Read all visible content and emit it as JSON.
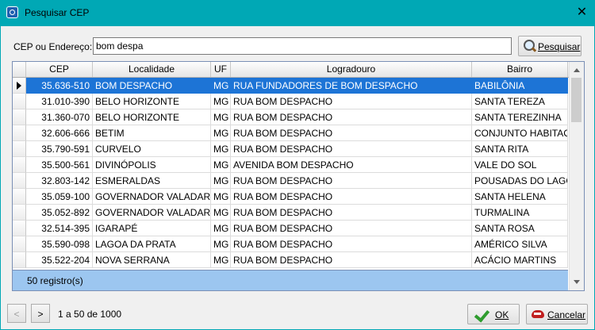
{
  "window": {
    "title": "Pesquisar CEP",
    "close_glyph": "✕"
  },
  "search": {
    "label": "CEP ou Endereço:",
    "value": "bom despa",
    "button_label": "Pesquisar"
  },
  "grid": {
    "columns": [
      "CEP",
      "Localidade",
      "UF",
      "Logradouro",
      "Bairro"
    ],
    "rows": [
      [
        "35.636-510",
        "BOM DESPACHO",
        "MG",
        "RUA FUNDADORES DE BOM DESPACHO",
        "BABILÔNIA"
      ],
      [
        "31.010-390",
        "BELO HORIZONTE",
        "MG",
        "RUA BOM DESPACHO",
        "SANTA TEREZA"
      ],
      [
        "31.360-070",
        "BELO HORIZONTE",
        "MG",
        "RUA BOM DESPACHO",
        "SANTA TEREZINHA"
      ],
      [
        "32.606-666",
        "BETIM",
        "MG",
        "RUA BOM DESPACHO",
        "CONJUNTO HABITACIONAL"
      ],
      [
        "35.790-591",
        "CURVELO",
        "MG",
        "RUA BOM DESPACHO",
        "SANTA RITA"
      ],
      [
        "35.500-561",
        "DIVINÓPOLIS",
        "MG",
        "AVENIDA BOM DESPACHO",
        "VALE DO SOL"
      ],
      [
        "32.803-142",
        "ESMERALDAS",
        "MG",
        "RUA BOM DESPACHO",
        "POUSADAS DO LAGO"
      ],
      [
        "35.059-100",
        "GOVERNADOR VALADARES",
        "MG",
        "RUA BOM DESPACHO",
        "SANTA HELENA"
      ],
      [
        "35.052-892",
        "GOVERNADOR VALADARES",
        "MG",
        "RUA BOM DESPACHO",
        "TURMALINA"
      ],
      [
        "32.514-395",
        "IGARAPÉ",
        "MG",
        "RUA BOM DESPACHO",
        "SANTA ROSA"
      ],
      [
        "35.590-098",
        "LAGOA DA PRATA",
        "MG",
        "RUA BOM DESPACHO",
        "AMÉRICO SILVA"
      ],
      [
        "35.522-204",
        "NOVA SERRANA",
        "MG",
        "RUA BOM DESPACHO",
        "ACÁCIO MARTINS"
      ]
    ],
    "selected_row": 0,
    "record_count": "50 registro(s)"
  },
  "pager": {
    "prev_label": "<",
    "next_label": ">",
    "info": "1 a 50 de 1000"
  },
  "buttons": {
    "ok_label": "OK",
    "cancel_label": "Cancelar"
  },
  "colors": {
    "title_bar": "#00a8b5",
    "selection": "#1d74d6",
    "footer": "#9cc6f0"
  }
}
